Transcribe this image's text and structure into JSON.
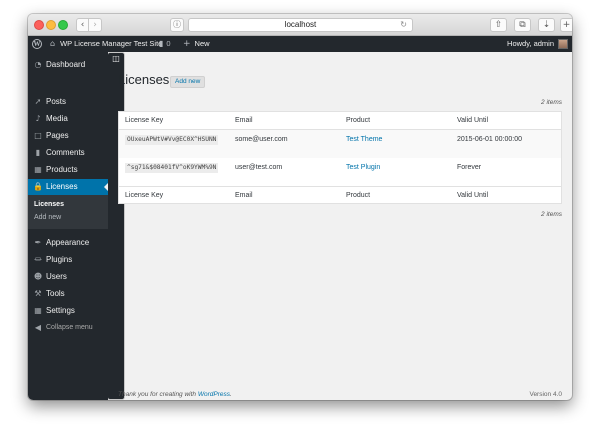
{
  "browser": {
    "url": "localhost"
  },
  "adminbar": {
    "site_name": "WP License Manager Test Site",
    "comments_count": "0",
    "new_label": "New",
    "howdy": "Howdy, admin"
  },
  "sidebar": {
    "items": [
      {
        "label": "Dashboard"
      },
      {
        "label": "Posts"
      },
      {
        "label": "Media"
      },
      {
        "label": "Pages"
      },
      {
        "label": "Comments"
      },
      {
        "label": "Products"
      },
      {
        "label": "Licenses"
      },
      {
        "label": "Appearance"
      },
      {
        "label": "Plugins"
      },
      {
        "label": "Users"
      },
      {
        "label": "Tools"
      },
      {
        "label": "Settings"
      }
    ],
    "submenu": [
      "Licenses",
      "Add new"
    ],
    "collapse_label": "Collapse menu"
  },
  "page": {
    "title": "Licenses",
    "add_new_label": "Add new",
    "item_count": "2 items",
    "columns": [
      "License Key",
      "Email",
      "Product",
      "Valid Until"
    ],
    "rows": [
      {
        "key": "OUxeuAPWtV#Vv@EC0X^HSUNN",
        "email": "some@user.com",
        "product": "Test Theme",
        "valid_until": "2015-06-01 00:00:00"
      },
      {
        "key": "^sg71&$08401fV^oK9YWM%9N",
        "email": "user@test.com",
        "product": "Test Plugin",
        "valid_until": "Forever"
      }
    ]
  },
  "footer": {
    "thanks_prefix": "Thank you for creating with ",
    "wordpress_link": "WordPress",
    "thanks_suffix": ".",
    "version": "Version 4.0"
  }
}
